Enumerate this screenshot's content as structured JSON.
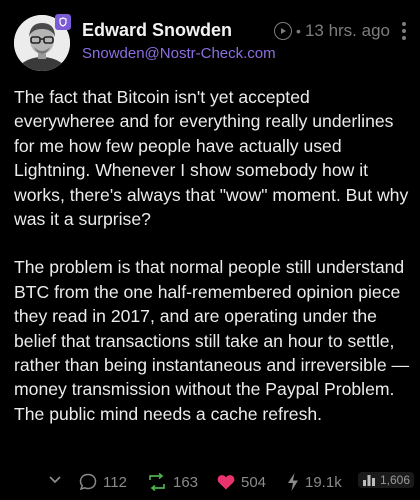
{
  "author": {
    "name": "Edward Snowden",
    "nip05": "Snowden@Nostr-Check.com"
  },
  "meta": {
    "timestamp": "13 hrs. ago",
    "separator": "•"
  },
  "post": {
    "paragraph_1": "The fact that Bitcoin isn't yet accepted everywheree and for everything really underlines for me how few people have actually used Lightning. Whenever I show somebody how it works, there's always that \"wow\" moment. But why was it a surprise?",
    "paragraph_2": "The problem is that normal people still understand BTC from the one half-remembered opinion piece they read in 2017, and are operating under the belief that transactions still take an hour to settle, rather than being instantaneous and irreversible — money transmission without the Paypal Problem. The public mind needs a cache refresh."
  },
  "actions": {
    "replies": "112",
    "reposts": "163",
    "likes": "504",
    "zaps": "19.1k",
    "views": "1,606"
  },
  "icons": {
    "verify": "verified-badge-icon",
    "play": "play-circle-icon",
    "more": "more-vertical-icon",
    "expand": "chevron-down-icon",
    "reply": "comment-icon",
    "repost": "repost-icon",
    "like": "heart-icon",
    "zap": "lightning-icon",
    "views": "bar-chart-icon"
  },
  "colors": {
    "accent": "#8c6fe0",
    "repost": "#4caf50",
    "like": "#e8336d",
    "background": "#000000"
  }
}
